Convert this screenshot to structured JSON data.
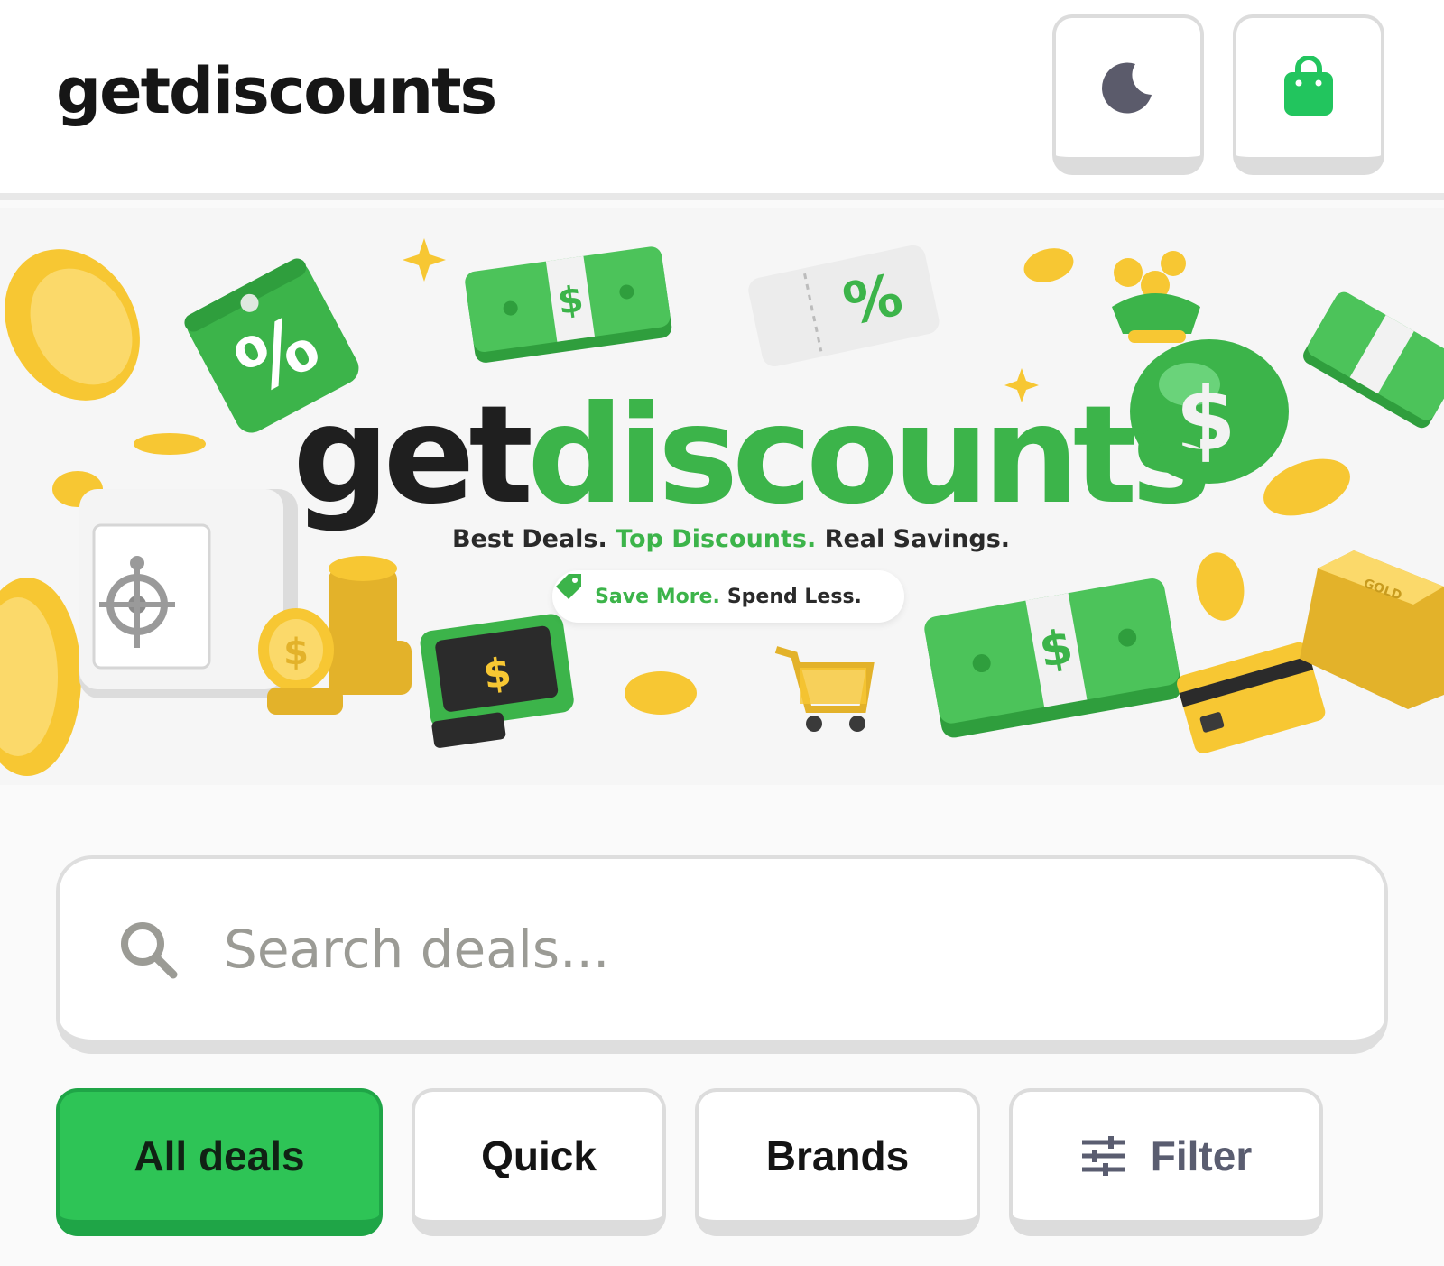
{
  "header": {
    "logo": "getdiscounts",
    "theme_icon": "moon-icon",
    "cart_icon": "shopping-bag-icon"
  },
  "banner": {
    "brand_dark": "get",
    "brand_green": "discounts",
    "tagline_1": "Best Deals.",
    "tagline_2": "Top Discounts.",
    "tagline_3": "Real Savings.",
    "pill_green": "Save More.",
    "pill_dark": "Spend Less.",
    "tag_symbol": "%",
    "coupon_symbol": "%",
    "currency_symbol": "$",
    "gold_label": "GOLD"
  },
  "search": {
    "placeholder": "Search deals..."
  },
  "filters": {
    "all": "All deals",
    "quick": "Quick",
    "brands": "Brands",
    "filter": "Filter"
  },
  "colors": {
    "accent": "#2ec456",
    "brand_green": "#3cb44a",
    "moon": "#5b5b6b",
    "coin": "#f7c733"
  }
}
